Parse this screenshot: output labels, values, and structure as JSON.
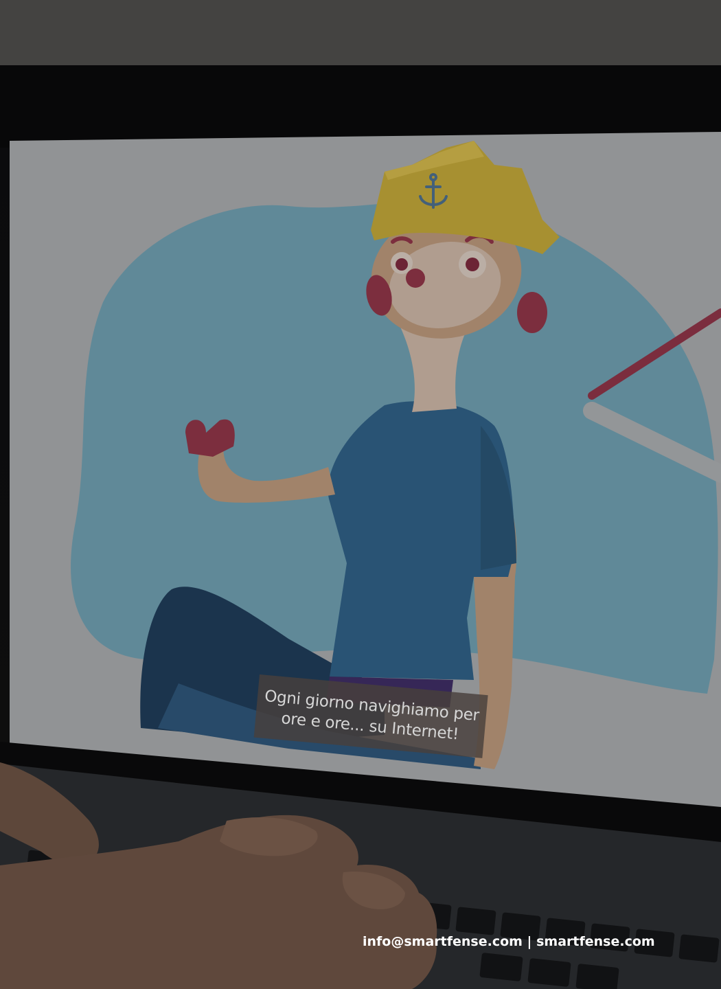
{
  "image": {
    "subtitle_line1": "Ogni giorno navighiamo per",
    "subtitle_line2": "ore e ore... su Internet!",
    "footer_contact": "info@smartfense.com | smartfense.com",
    "icons": [
      "anchor-icon"
    ],
    "colors": {
      "screen_background": "#a7a9ab",
      "blob": "#6f9cad",
      "hat": "#bfa438",
      "shirt": "#2f5f84",
      "skin": "#b89679",
      "accent_pink": "#8e3547",
      "dark_overlay": "#111315"
    }
  }
}
